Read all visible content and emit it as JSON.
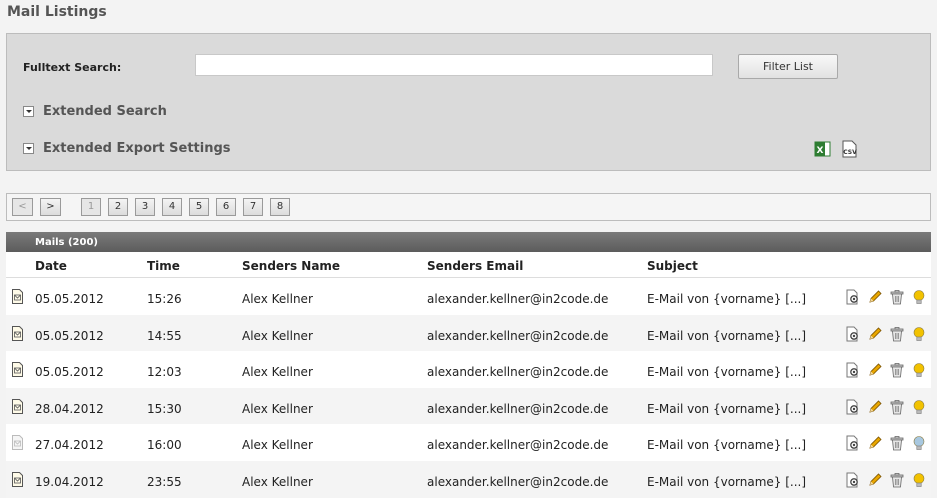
{
  "page": {
    "title": "Mail Listings"
  },
  "search": {
    "fulltext_label": "Fulltext Search:",
    "fulltext_value": "",
    "filter_button": "Filter List",
    "extended_search": "Extended Search",
    "extended_export": "Extended Export Settings",
    "export_icons": [
      "excel-export-icon",
      "csv-export-icon"
    ]
  },
  "pager": {
    "prev": "<",
    "next": ">",
    "pages": [
      "1",
      "2",
      "3",
      "4",
      "5",
      "6",
      "7",
      "8"
    ],
    "current": "1"
  },
  "mails": {
    "title": "Mails (200)",
    "columns": [
      "Date",
      "Time",
      "Senders Name",
      "Senders Email",
      "Subject"
    ],
    "rows": [
      {
        "date": "05.05.2012",
        "time": "15:26",
        "name": "Alex Kellner",
        "email": "alexander.kellner@in2code.de",
        "subject": "E-Mail von {vorname} [...]",
        "hidden": false
      },
      {
        "date": "05.05.2012",
        "time": "14:55",
        "name": "Alex Kellner",
        "email": "alexander.kellner@in2code.de",
        "subject": "E-Mail von {vorname} [...]",
        "hidden": false
      },
      {
        "date": "05.05.2012",
        "time": "12:03",
        "name": "Alex Kellner",
        "email": "alexander.kellner@in2code.de",
        "subject": "E-Mail von {vorname} [...]",
        "hidden": false
      },
      {
        "date": "28.04.2012",
        "time": "15:30",
        "name": "Alex Kellner",
        "email": "alexander.kellner@in2code.de",
        "subject": "E-Mail von {vorname} [...]",
        "hidden": false
      },
      {
        "date": "27.04.2012",
        "time": "16:00",
        "name": "Alex Kellner",
        "email": "alexander.kellner@in2code.de",
        "subject": "E-Mail von {vorname} [...]",
        "hidden": true
      },
      {
        "date": "19.04.2012",
        "time": "23:55",
        "name": "Alex Kellner",
        "email": "alexander.kellner@in2code.de",
        "subject": "E-Mail von {vorname} [...]",
        "hidden": false
      }
    ],
    "row_actions": [
      "view-icon",
      "edit-pencil-icon",
      "delete-trash-icon",
      "visibility-bulb-icon"
    ]
  },
  "colors": {
    "bulb_on": "#f2c200",
    "bulb_off": "#a8c8e0",
    "pencil": "#e8a600"
  }
}
